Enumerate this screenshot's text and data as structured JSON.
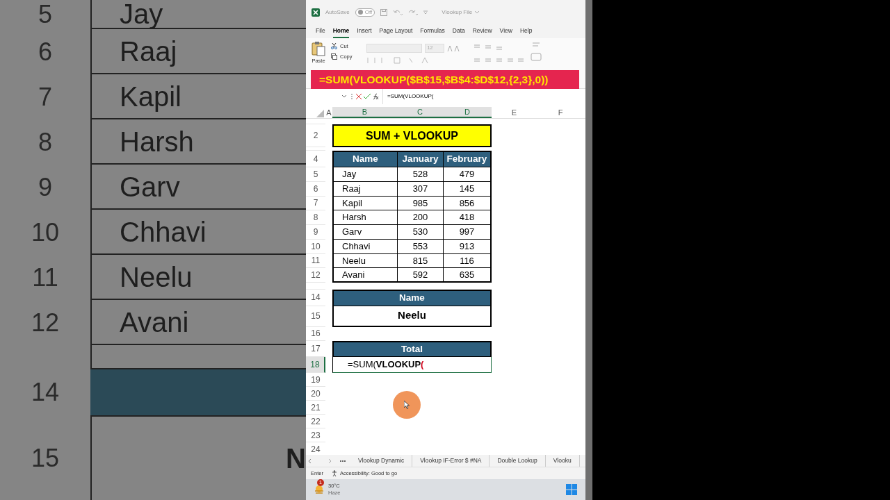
{
  "backdrop": {
    "rows": [
      {
        "kind": "data",
        "number": "5",
        "name": "Jay"
      },
      {
        "kind": "data",
        "number": "6",
        "name": "Raaj"
      },
      {
        "kind": "data",
        "number": "7",
        "name": "Kapil"
      },
      {
        "kind": "data",
        "number": "8",
        "name": "Harsh"
      },
      {
        "kind": "data",
        "number": "9",
        "name": "Garv"
      },
      {
        "kind": "data",
        "number": "10",
        "name": "Chhavi"
      },
      {
        "kind": "data",
        "number": "11",
        "name": "Neelu"
      },
      {
        "kind": "data",
        "number": "12",
        "name": "Avani"
      },
      {
        "kind": "stub"
      },
      {
        "kind": "header",
        "number": "14"
      },
      {
        "kind": "value",
        "number": "15",
        "name": "N"
      }
    ]
  },
  "title_bar": {
    "autosave": "AutoSave",
    "toggle": {
      "label": "Off",
      "on": false
    },
    "file_name": "Vlookup File"
  },
  "menu_tabs": [
    {
      "label": "File",
      "selected": false
    },
    {
      "label": "Home",
      "selected": true
    },
    {
      "label": "Insert",
      "selected": false
    },
    {
      "label": "Page Layout",
      "selected": false
    },
    {
      "label": "Formulas",
      "selected": false
    },
    {
      "label": "Data",
      "selected": false
    },
    {
      "label": "Review",
      "selected": false
    },
    {
      "label": "View",
      "selected": false
    },
    {
      "label": "Help",
      "selected": false
    }
  ],
  "ribbon": {
    "paste": "Paste",
    "cut": "Cut",
    "copy": "Copy",
    "font_size": "12"
  },
  "banner": "=SUM(VLOOKUP($B$15,$B$4:$D$12,{2,3},0))",
  "formula_bar": {
    "content": "=SUM(VLOOKUP("
  },
  "columns": [
    {
      "label": "A",
      "selected": false
    },
    {
      "label": "B",
      "selected": true
    },
    {
      "label": "C",
      "selected": true
    },
    {
      "label": "D",
      "selected": true
    },
    {
      "label": "E",
      "selected": false
    },
    {
      "label": "F",
      "selected": false
    }
  ],
  "rows": [
    {
      "kind": "stub"
    },
    {
      "kind": "title",
      "number": "2",
      "text": "SUM + VLOOKUP"
    },
    {
      "kind": "stub"
    },
    {
      "kind": "header",
      "number": "4",
      "cells": [
        "Name",
        "January",
        "February"
      ]
    },
    {
      "kind": "data",
      "number": "5",
      "cells": [
        "Jay",
        "528",
        "479"
      ]
    },
    {
      "kind": "data",
      "number": "6",
      "cells": [
        "Raaj",
        "307",
        "145"
      ]
    },
    {
      "kind": "data",
      "number": "7",
      "cells": [
        "Kapil",
        "985",
        "856"
      ]
    },
    {
      "kind": "data",
      "number": "8",
      "cells": [
        "Harsh",
        "200",
        "418"
      ]
    },
    {
      "kind": "data",
      "number": "9",
      "cells": [
        "Garv",
        "530",
        "997"
      ]
    },
    {
      "kind": "data",
      "number": "10",
      "cells": [
        "Chhavi",
        "553",
        "913"
      ]
    },
    {
      "kind": "data",
      "number": "11",
      "cells": [
        "Neelu",
        "815",
        "116"
      ]
    },
    {
      "kind": "data",
      "number": "12",
      "cells": [
        "Avani",
        "592",
        "635"
      ]
    },
    {
      "kind": "stub"
    },
    {
      "kind": "box_header",
      "number": "14",
      "text": "Name"
    },
    {
      "kind": "box_value",
      "number": "15",
      "text": "Neelu"
    },
    {
      "kind": "blank",
      "number": "16"
    },
    {
      "kind": "box_header",
      "number": "17",
      "text": "Total"
    },
    {
      "kind": "input",
      "number": "18",
      "selected": true,
      "segments": [
        {
          "kind": "plain",
          "text": "=SUM("
        },
        {
          "kind": "bold",
          "text": "VLOOKUP"
        },
        {
          "kind": "red",
          "text": "("
        }
      ]
    },
    {
      "kind": "blank",
      "number": "19"
    },
    {
      "kind": "blank",
      "number": "20"
    },
    {
      "kind": "blank",
      "number": "21"
    },
    {
      "kind": "blank",
      "number": "22"
    },
    {
      "kind": "blank",
      "number": "23"
    },
    {
      "kind": "blank",
      "number": "24"
    }
  ],
  "sheet_tabs": [
    {
      "label": "Vlookup Dynamic",
      "selected": false
    },
    {
      "label": "Vlookup IF-Error $ #NA",
      "selected": false
    },
    {
      "label": "Double Lookup",
      "selected": false
    },
    {
      "label": "Vlooku",
      "selected": false
    }
  ],
  "status_bar": {
    "mode": "Enter",
    "accessibility": "Accessibility: Good to go"
  },
  "taskbar": {
    "badge": "1",
    "temperature": "30°C",
    "condition": "Haze"
  }
}
